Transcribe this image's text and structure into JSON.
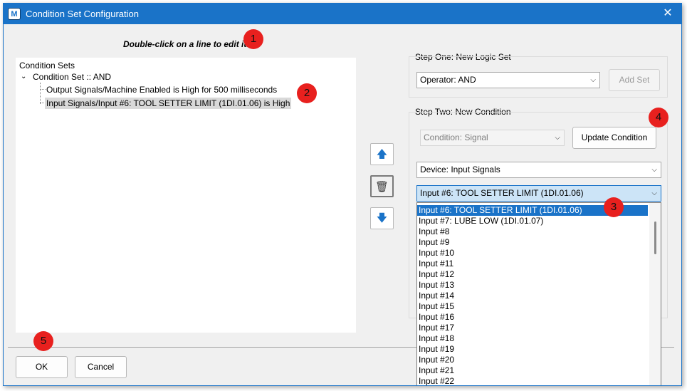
{
  "window": {
    "title": "Condition Set Configuration",
    "icon_text": "M",
    "close_glyph": "✕"
  },
  "hint": "Double-click on a line to edit it.",
  "tree": {
    "root_label": "Condition Sets",
    "expand_glyph": "⌄",
    "set_label": "Condition Set :: AND",
    "items": [
      {
        "label": "Output Signals/Machine Enabled is High for 500 milliseconds"
      },
      {
        "label": "Input Signals/Input #6: TOOL SETTER LIMIT (1DI.01.06) is High"
      }
    ]
  },
  "side_buttons": {
    "up_glyph": "🡅",
    "trash_glyph": "🗑",
    "down_glyph": "🡇"
  },
  "step_one": {
    "label": "Step One: New Logic Set",
    "operator_value": "Operator: AND",
    "add_set_label": "Add Set"
  },
  "step_two": {
    "label": "Step Two: New Condition",
    "condition_value": "Condition: Signal",
    "update_label": "Update Condition",
    "device_value": "Device: Input Signals",
    "input_value": "Input #6: TOOL SETTER LIMIT (1DI.01.06)"
  },
  "combo_arrow": "⌵",
  "dropdown": {
    "options": [
      "Input #6: TOOL SETTER LIMIT (1DI.01.06)",
      "Input #7: LUBE LOW (1DI.01.07)",
      "Input #8",
      "Input #9",
      "Input #10",
      "Input #11",
      "Input #12",
      "Input #13",
      "Input #14",
      "Input #15",
      "Input #16",
      "Input #17",
      "Input #18",
      "Input #19",
      "Input #20",
      "Input #21",
      "Input #22"
    ],
    "selected_index": 0
  },
  "footer": {
    "ok_label": "OK",
    "cancel_label": "Cancel"
  },
  "markers": [
    "1",
    "2",
    "3",
    "4",
    "5"
  ],
  "colors": {
    "title_bar": "#1a73c8",
    "selection": "#1a73c8",
    "marker": "#e8201e"
  }
}
